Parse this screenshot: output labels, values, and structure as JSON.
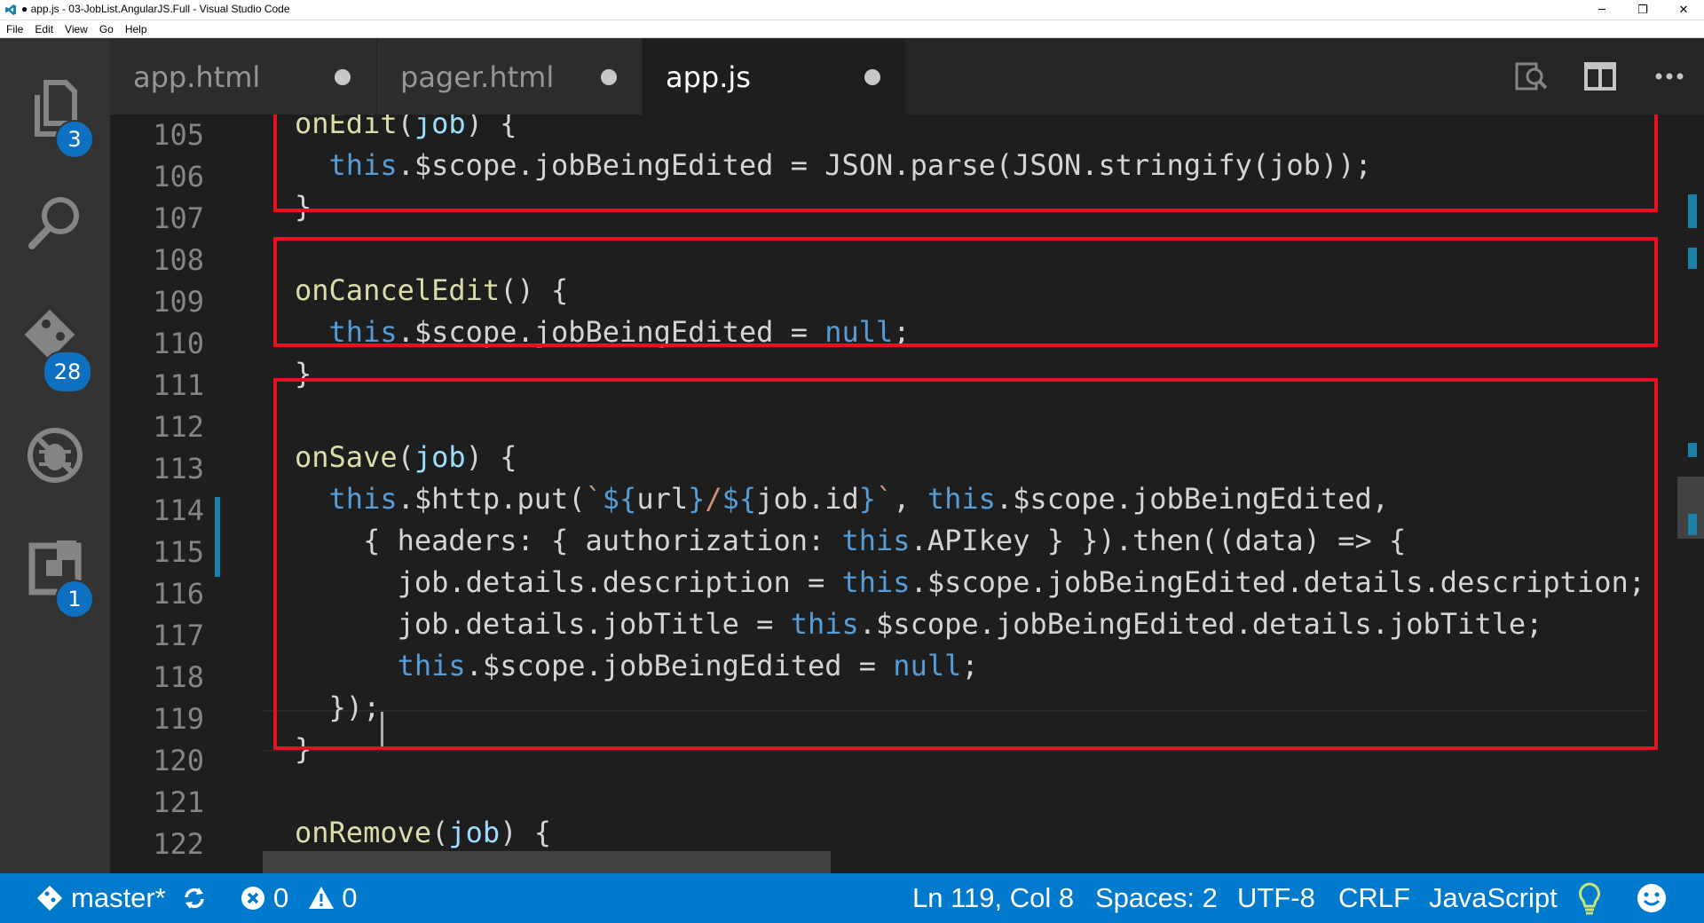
{
  "window": {
    "title": "● app.js - 03-JobList.AngularJS.Full - Visual Studio Code",
    "controls": [
      "─",
      "❐",
      "✕"
    ]
  },
  "menu": [
    "File",
    "Edit",
    "View",
    "Go",
    "Help"
  ],
  "activity": {
    "explorer_badge": "3",
    "git_badge": "28",
    "extensions_badge": "1"
  },
  "tabs": [
    {
      "label": "app.html",
      "dirty": true
    },
    {
      "label": "pager.html",
      "dirty": true
    },
    {
      "label": "app.js",
      "dirty": true,
      "active": true
    }
  ],
  "editor": {
    "line_numbers": [
      "105",
      "106",
      "107",
      "108",
      "109",
      "110",
      "111",
      "112",
      "113",
      "114",
      "115",
      "116",
      "117",
      "118",
      "119",
      "120",
      "121",
      "122"
    ],
    "cursor_line": "119"
  },
  "status": {
    "branch": "master*",
    "errors": "0",
    "warnings": "0",
    "position": "Ln 119, Col 8",
    "spaces": "Spaces: 2",
    "encoding": "UTF-8",
    "eol": "CRLF",
    "language": "JavaScript"
  },
  "colors": {
    "accent": "#007acc",
    "highlight_box": "#e81123",
    "badge": "#0e70c0"
  }
}
